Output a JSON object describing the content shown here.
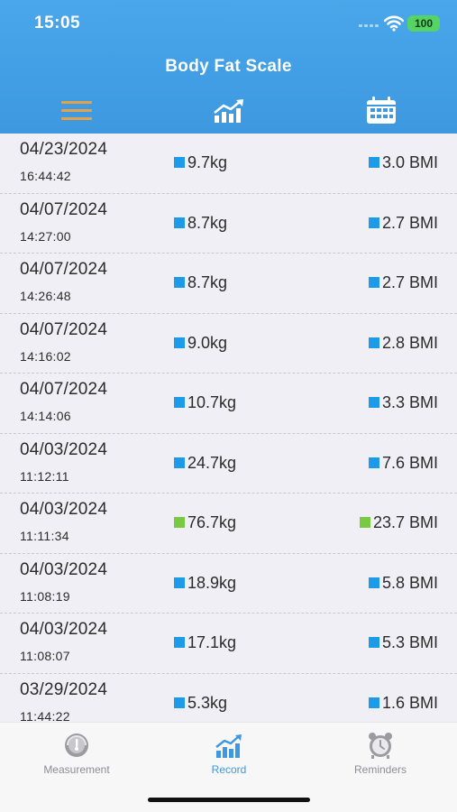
{
  "status_bar": {
    "time": "15:05",
    "battery": "100"
  },
  "header": {
    "title": "Body Fat Scale",
    "tab_icons": [
      "menu-icon",
      "chart-icon",
      "calendar-icon"
    ]
  },
  "colors": {
    "header_blue": "#3d98e0",
    "menu_orange": "#e2a24c",
    "indicator_blue": "#1e9be8",
    "indicator_green": "#7ac943",
    "battery_green": "#56d364"
  },
  "records": [
    {
      "date": "04/23/2024",
      "time": "16:44:42",
      "weight": "9.7kg",
      "bmi": "3.0 BMI",
      "status": "blue"
    },
    {
      "date": "04/07/2024",
      "time": "14:27:00",
      "weight": "8.7kg",
      "bmi": "2.7 BMI",
      "status": "blue"
    },
    {
      "date": "04/07/2024",
      "time": "14:26:48",
      "weight": "8.7kg",
      "bmi": "2.7 BMI",
      "status": "blue"
    },
    {
      "date": "04/07/2024",
      "time": "14:16:02",
      "weight": "9.0kg",
      "bmi": "2.8 BMI",
      "status": "blue"
    },
    {
      "date": "04/07/2024",
      "time": "14:14:06",
      "weight": "10.7kg",
      "bmi": "3.3 BMI",
      "status": "blue"
    },
    {
      "date": "04/03/2024",
      "time": "11:12:11",
      "weight": "24.7kg",
      "bmi": "7.6 BMI",
      "status": "blue"
    },
    {
      "date": "04/03/2024",
      "time": "11:11:34",
      "weight": "76.7kg",
      "bmi": "23.7 BMI",
      "status": "green"
    },
    {
      "date": "04/03/2024",
      "time": "11:08:19",
      "weight": "18.9kg",
      "bmi": "5.8 BMI",
      "status": "blue"
    },
    {
      "date": "04/03/2024",
      "time": "11:08:07",
      "weight": "17.1kg",
      "bmi": "5.3 BMI",
      "status": "blue"
    },
    {
      "date": "03/29/2024",
      "time": "11:44:22",
      "weight": "5.3kg",
      "bmi": "1.6 BMI",
      "status": "blue"
    }
  ],
  "tab_bar": {
    "items": [
      {
        "label": "Measurement",
        "icon": "gauge-icon",
        "active": false
      },
      {
        "label": "Record",
        "icon": "chart-icon",
        "active": true
      },
      {
        "label": "Reminders",
        "icon": "alarm-clock-icon",
        "active": false
      }
    ]
  }
}
